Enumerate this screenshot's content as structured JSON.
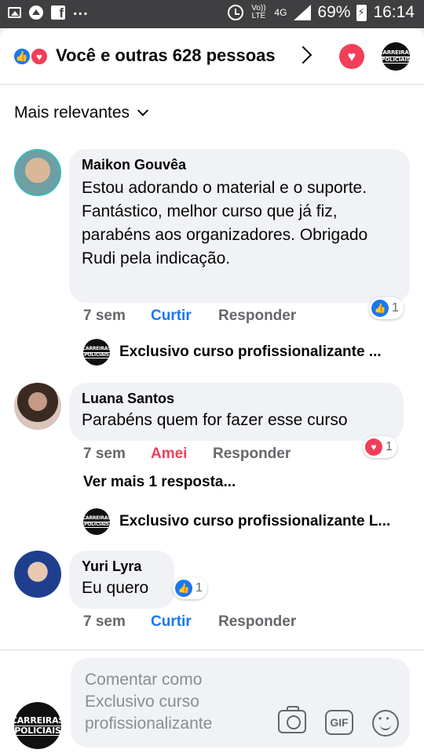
{
  "status_bar": {
    "dots": "...",
    "volte": "Vo)) LTE",
    "network": "4G",
    "battery": "69%",
    "time": "16:14",
    "fb_glyph": "f"
  },
  "header": {
    "reactions_text": "Você e outras 628 pessoas",
    "icons": [
      "like-icon",
      "love-icon",
      "chevron-right-icon",
      "love-icon",
      "page-avatar"
    ]
  },
  "sort": {
    "label": "Mais relevantes"
  },
  "logo": {
    "line1": "CARREIRAS",
    "line2": "POLICIAIS"
  },
  "comments": [
    {
      "author": "Maikon Gouvêa",
      "text": "Estou adorando o material e o suporte. Fantástico, melhor curso que já fiz, parabéns aos organizadores. Obrigado Rudi pela indicação.",
      "time": "7 sem",
      "like_action": "Curtir",
      "reply_action": "Responder",
      "reaction_count": "1",
      "reply_preview": "Exclusivo curso profissionalizante ..."
    },
    {
      "author": "Luana Santos",
      "text": "Parabéns quem for fazer esse curso",
      "time": "7 sem",
      "like_action": "Amei",
      "reply_action": "Responder",
      "reaction_count": "1",
      "more_replies": "Ver mais 1 resposta...",
      "reply_preview": "Exclusivo curso profissionalizante L..."
    },
    {
      "author": "Yuri Lyra",
      "text": "Eu quero",
      "time": "7 sem",
      "like_action": "Curtir",
      "reply_action": "Responder",
      "reaction_count": "1"
    }
  ],
  "composer": {
    "placeholder": "Comentar como Exclusivo curso profissionalizante",
    "gif_label": "GIF"
  },
  "colors": {
    "accent_blue": "#1877f2",
    "love_red": "#f33e58",
    "status_bar_bg": "#3f3f41",
    "bubble_bg": "#f0f2f5"
  }
}
